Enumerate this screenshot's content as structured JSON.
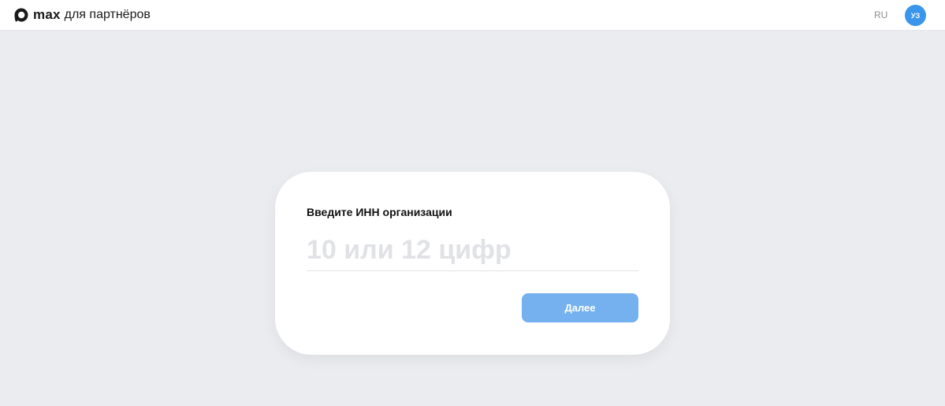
{
  "header": {
    "logo_text": "max",
    "logo_subtitle": "для партнёров",
    "language": "RU",
    "avatar_initials": "УЗ"
  },
  "form": {
    "title": "Введите ИНН организации",
    "inn_value": "",
    "inn_placeholder": "10 или 12 цифр",
    "next_label": "Далее"
  },
  "colors": {
    "background": "#ebecef",
    "avatar": "#3b95ea",
    "button": "#74b1ee",
    "placeholder": "#e1e2e5"
  },
  "icons": {
    "logo": "max-logo-icon"
  }
}
